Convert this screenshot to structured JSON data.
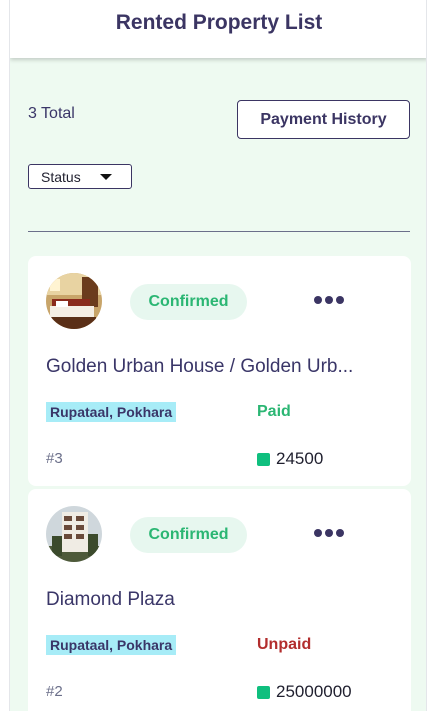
{
  "header": {
    "title": "Rented Property List"
  },
  "summary": {
    "total": "3 Total",
    "payment_history_label": "Payment History"
  },
  "filter": {
    "status_label": "Status"
  },
  "properties": [
    {
      "badge": "Confirmed",
      "name": "Golden Urban House / Golden Urb...",
      "location": "Rupataal, Pokhara",
      "payment_status": "Paid",
      "id": "#3",
      "amount": "24500"
    },
    {
      "badge": "Confirmed",
      "name": "Diamond Plaza",
      "location": "Rupataal, Pokhara",
      "payment_status": "Unpaid",
      "id": "#2",
      "amount": "25000000"
    }
  ],
  "colors": {
    "primary": "#3b3563",
    "confirmed": "#2bb673",
    "paid": "#2bb673",
    "unpaid": "#b22d2d",
    "location_tag": "#a7ecf7",
    "background": "#eefaf1"
  }
}
